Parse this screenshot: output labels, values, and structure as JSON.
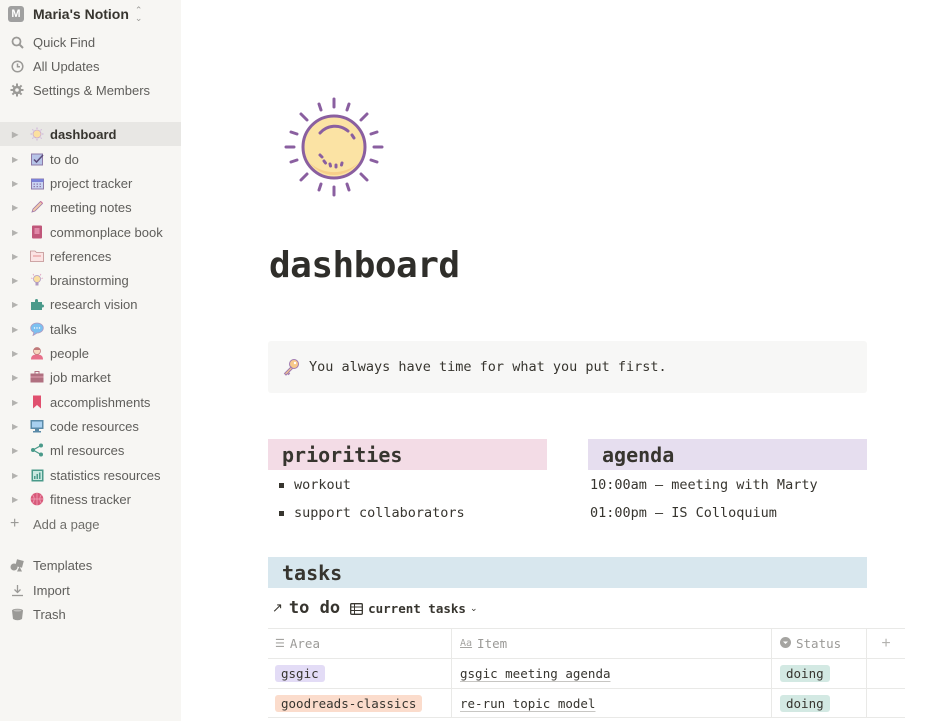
{
  "workspace": {
    "avatar_letter": "M",
    "name": "Maria's Notion"
  },
  "sidebar": {
    "nav": [
      {
        "label": "Quick Find",
        "icon": "search-icon"
      },
      {
        "label": "All Updates",
        "icon": "clock-icon"
      },
      {
        "label": "Settings & Members",
        "icon": "gear-icon"
      }
    ],
    "pages": [
      {
        "label": "dashboard",
        "icon": "sun-icon",
        "active": true
      },
      {
        "label": "to do",
        "icon": "checkbox-icon"
      },
      {
        "label": "project tracker",
        "icon": "calendar-icon"
      },
      {
        "label": "meeting notes",
        "icon": "pencil-icon"
      },
      {
        "label": "commonplace book",
        "icon": "book-icon"
      },
      {
        "label": "references",
        "icon": "folder-icon"
      },
      {
        "label": "brainstorming",
        "icon": "lightbulb-icon"
      },
      {
        "label": "research vision",
        "icon": "puzzle-icon"
      },
      {
        "label": "talks",
        "icon": "speech-bubble-icon"
      },
      {
        "label": "people",
        "icon": "person-icon"
      },
      {
        "label": "job market",
        "icon": "briefcase-icon"
      },
      {
        "label": "accomplishments",
        "icon": "bookmark-icon"
      },
      {
        "label": "code resources",
        "icon": "monitor-code-icon"
      },
      {
        "label": "ml resources",
        "icon": "share-nodes-icon"
      },
      {
        "label": "statistics resources",
        "icon": "bar-chart-icon"
      },
      {
        "label": "fitness tracker",
        "icon": "basketball-icon"
      }
    ],
    "add_page": "Add a page",
    "bottom": [
      {
        "label": "Templates",
        "icon": "templates-icon"
      },
      {
        "label": "Import",
        "icon": "download-icon"
      },
      {
        "label": "Trash",
        "icon": "trash-icon"
      }
    ]
  },
  "page": {
    "icon": "sun-icon",
    "title": "dashboard",
    "callout": {
      "icon": "key-icon",
      "text": "You always have time for what you put first."
    },
    "priorities": {
      "heading": "priorities",
      "items": [
        "workout",
        "support collaborators"
      ]
    },
    "agenda": {
      "heading": "agenda",
      "items": [
        "10:00am — meeting with Marty",
        "01:00pm — IS Colloquium"
      ]
    },
    "tasks": {
      "heading": "tasks",
      "linked_db": {
        "title": "to do",
        "view": "current tasks"
      },
      "columns": [
        {
          "label": "Area",
          "icon": "list-icon"
        },
        {
          "label": "Item",
          "icon": "text-aa-icon"
        },
        {
          "label": "Status",
          "icon": "select-icon"
        }
      ],
      "rows": [
        {
          "area": "gsgic",
          "area_color": "#e3dcf6",
          "item": "gsgic meeting agenda",
          "status": "doing",
          "status_color": "#d3e9e3"
        },
        {
          "area": "goodreads-classics",
          "area_color": "#fbdccc",
          "item": "re-run topic model",
          "status": "doing",
          "status_color": "#d3e9e3"
        }
      ]
    }
  }
}
